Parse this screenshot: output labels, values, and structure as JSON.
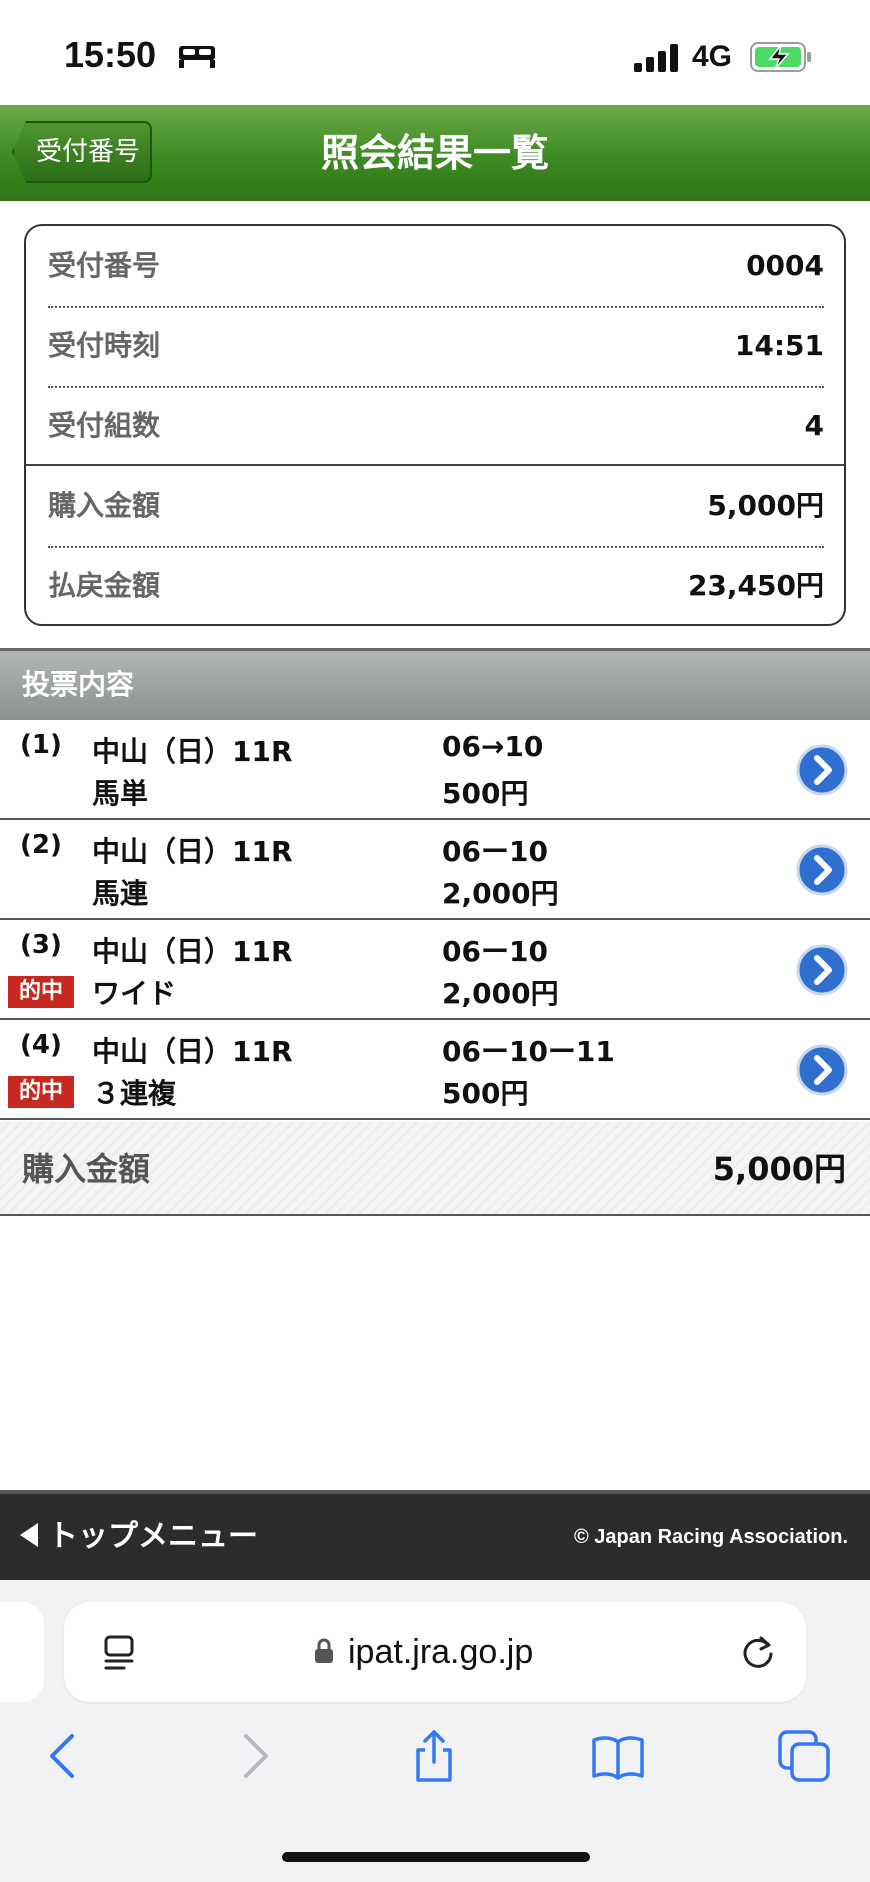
{
  "status_bar": {
    "time": "15:50",
    "network": "4G",
    "battery_color": "#4cd964"
  },
  "header": {
    "back_label": "受付番号",
    "title": "照会結果一覧",
    "color": "#3e8a22"
  },
  "summary": {
    "rows": [
      {
        "label": "受付番号",
        "value": "0004"
      },
      {
        "label": "受付時刻",
        "value": "14:51"
      },
      {
        "label": "受付組数",
        "value": "4"
      },
      {
        "label": "購入金額",
        "value": "5,000円"
      },
      {
        "label": "払戻金額",
        "value": "23,450円"
      }
    ]
  },
  "votes": {
    "section_title": "投票内容",
    "hit_label": "的中",
    "items": [
      {
        "index": "(1)",
        "race": "中山（日）11R",
        "bet_type": "馬単",
        "combination": "06→10",
        "amount": "500円",
        "hit": false
      },
      {
        "index": "(2)",
        "race": "中山（日）11R",
        "bet_type": "馬連",
        "combination": "06ー10",
        "amount": "2,000円",
        "hit": false
      },
      {
        "index": "(3)",
        "race": "中山（日）11R",
        "bet_type": "ワイド",
        "combination": "06ー10",
        "amount": "2,000円",
        "hit": true
      },
      {
        "index": "(4)",
        "race": "中山（日）11R",
        "bet_type": "３連複",
        "combination": "06ー10ー11",
        "amount": "500円",
        "hit": true
      }
    ],
    "total_label": "購入金額",
    "total_value": "5,000円"
  },
  "footer": {
    "top_menu": "トップメニュー",
    "copyright": "© Japan Racing Association."
  },
  "browser": {
    "url": "ipat.jra.go.jp",
    "icon_color": "#3478f6"
  },
  "icons": [
    "bed-icon",
    "signal-icon",
    "battery-icon",
    "chevron-right-icon",
    "reader-icon",
    "lock-icon",
    "reload-icon",
    "back-icon",
    "forward-icon",
    "share-icon",
    "bookmarks-icon",
    "tabs-icon"
  ]
}
